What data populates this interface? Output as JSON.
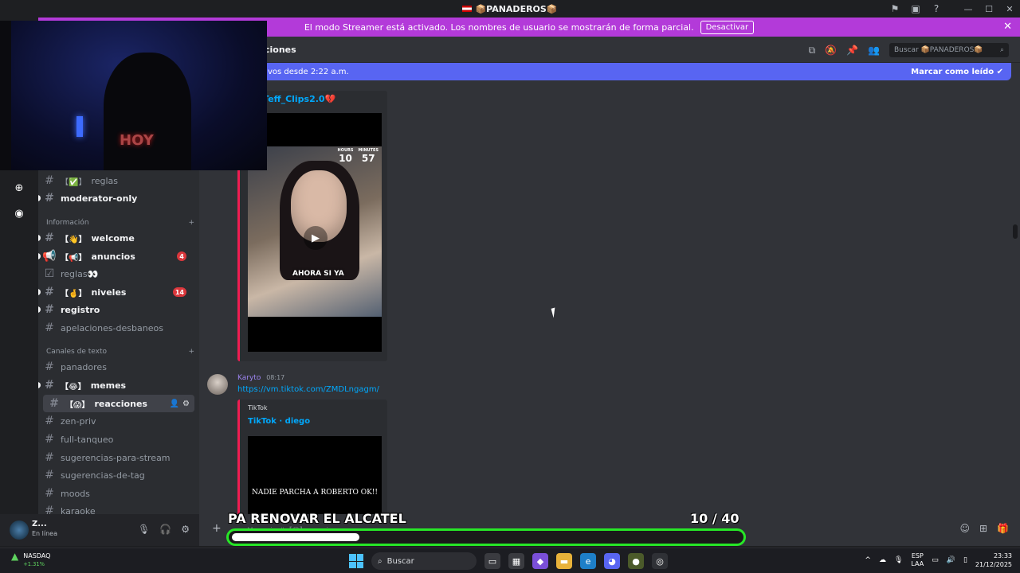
{
  "titlebar": {
    "server_name": "📦PANADEROS📦"
  },
  "streamer_banner": {
    "text": "El modo Streamer está activado. Los nombres de usuario se mostrarán de forma parcial.",
    "button": "Desactivar",
    "bg_color": "#b33ad9"
  },
  "sidebar": {
    "categories": [
      {
        "label": "Información"
      },
      {
        "label": "Canales de texto"
      }
    ],
    "channels": [
      {
        "name": "reglas",
        "emoji": "【✅】"
      },
      {
        "name": "moderator-only"
      },
      {
        "name": "welcome",
        "emoji": "【👋】"
      },
      {
        "name": "anuncios",
        "emoji": "【📢】",
        "badge": "4"
      },
      {
        "name": "reglas👀"
      },
      {
        "name": "niveles",
        "emoji": "【🤞】",
        "badge": "14"
      },
      {
        "name": "registro"
      },
      {
        "name": "apelaciones-desbaneos"
      },
      {
        "name": "panadores"
      },
      {
        "name": "memes",
        "emoji": "【😂】"
      },
      {
        "name": "reacciones",
        "emoji": "【😱】"
      },
      {
        "name": "zen-priv"
      },
      {
        "name": "full-tanqueo"
      },
      {
        "name": "sugerencias-para-stream"
      },
      {
        "name": "sugerencias-de-tag"
      },
      {
        "name": "moods"
      },
      {
        "name": "karaoke"
      }
    ]
  },
  "header": {
    "channel_title": "ciones",
    "search_placeholder": "Buscar 📦PANADEROS📦"
  },
  "new_messages_bar": {
    "text": "vos desde 2:22 a.m.",
    "action": "Marcar como leído",
    "color": "#5865f2"
  },
  "messages": {
    "embed1_title": "k · Teff_Clips2.0💔",
    "clock": {
      "hours_label": "HOURS",
      "minutes_label": "MINUTES",
      "hours": "10",
      "minutes": "57"
    },
    "video_caption": "AHORA SI YA",
    "msg2": {
      "author": "Karyto",
      "time": "08:17",
      "link": "https://vm.tiktok.com/ZMDLngagm/",
      "embed_provider": "TikTok",
      "embed_title": "TikTok · diego",
      "video_caption": "NADIE PARCHA A ROBERTO OK!!"
    }
  },
  "user_panel": {
    "name": "Z...",
    "status": "En línea"
  },
  "composer": {
    "placeholder": "Mensaje #【😱】reacciones"
  },
  "goal_overlay": {
    "title": "PA RENOVAR EL ALCATEL",
    "count": "10   / 40",
    "progress": 0.25,
    "color": "#27e727"
  },
  "taskbar": {
    "stock_name": "NASDAQ",
    "stock_change": "+1.31%",
    "search": "Buscar",
    "lang_top": "ESP",
    "lang_bottom": "LAA",
    "time": "23:33",
    "date": "21/12/2025"
  }
}
